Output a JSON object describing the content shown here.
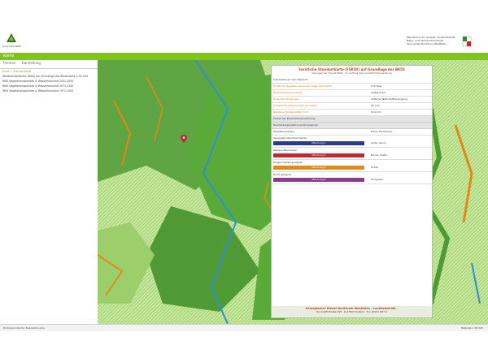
{
  "header": {
    "logo_caption": "Geoportal.NRW",
    "right_lines": [
      "Ministerium für Umwelt, Landwirtschaft,",
      "Natur- und Verbraucherschutz",
      "des Landes Nordrhein-Westfalen"
    ]
  },
  "topbar": {
    "title": "Karte"
  },
  "left_panel": {
    "tabs": [
      "Themen",
      "Darstellung"
    ],
    "layers": [
      {
        "label": "Karte + Standortkarte",
        "highlight": true
      },
      {
        "label": "Waldstandortkarte (WSK) auf Grundlage der Bodenkarte 1:50.000",
        "highlight": false
      },
      {
        "label": "WSK Vegetationsperiode & Wasserhaushalt 2041-2050",
        "highlight": false
      },
      {
        "label": "WSK Vegetationsperiode & Wasserhaushalt 2071-2100",
        "highlight": false
      },
      {
        "label": "WSK Vegetationsperiode & Wasserhaushalt 1971-2000",
        "highlight": false
      }
    ]
  },
  "legend": {
    "title": "Forstliche Standortkarte (FSK50) auf Grundlage der BK50",
    "subtitle": "Geologischer Dienst NRW - im Auftrag des Landesforstverwaltung",
    "rows": [
      {
        "k": "Informationen zum Standort",
        "v": ""
      },
      {
        "k": "Forstliche Vegetationsperiode (Tage) 1971-2000",
        "v": "172 Tage"
      },
      {
        "k": "Gesamtwasserhaushalt",
        "v": "mäßig frisch"
      },
      {
        "k": "Bodenstrukturgruppe",
        "v": "mittlerer Nährstoffversorgung"
      },
      {
        "k": "Klimatische Wasserbilanz (mm/Jahr)",
        "v": "55 mm"
      },
      {
        "k": "Nutzbare Feldkapazität (mm)",
        "v": "124 mm"
      }
    ],
    "modell_title": "Modell der Baumartenempfehlung",
    "sections": [
      {
        "label": "Baumartenempfehlung Klimawandel",
        "swatch": "",
        "color": "#e4e4e4",
        "value": ""
      },
      {
        "label": "Hauptbaumarten",
        "swatch": "",
        "color": "#ffffff",
        "value": "Eiche, Hainbuche"
      },
      {
        "label": "Geeignete Mischbaumarten",
        "swatch": "Mischung 1",
        "color": "#2c3b8c",
        "value": "Linde, Ahorn"
      },
      {
        "label": "Weitere Baumarten",
        "swatch": "Mischung 2",
        "color": "#c1272d",
        "value": "Buche, Kiefer"
      },
      {
        "label": "Eingeschränkt geeignet",
        "swatch": "Mischung 3",
        "color": "#e08a18",
        "value": "Fichte"
      },
      {
        "label": "Nicht geeignet",
        "swatch": "Mischung 4",
        "color": "#8a3c8f",
        "value": "Douglasie"
      }
    ],
    "footer_title": "Geologischer Dienst Nordrhein-Westfalen – Landesbetrieb –",
    "footer_text": "De-Greiff-Straße 195 · D-47803 Krefeld · Fon 02151 897-0"
  },
  "statusbar": {
    "left": "Hintergrundkarte: Basiskarte grau",
    "right": "Maßstab 1:25.000"
  },
  "colors": {
    "map_light": "#c7e79e",
    "map_dark": "#4f9a34",
    "water": "#2f8fd0",
    "orange": "#e08a18",
    "accent": "#7fc31c"
  }
}
